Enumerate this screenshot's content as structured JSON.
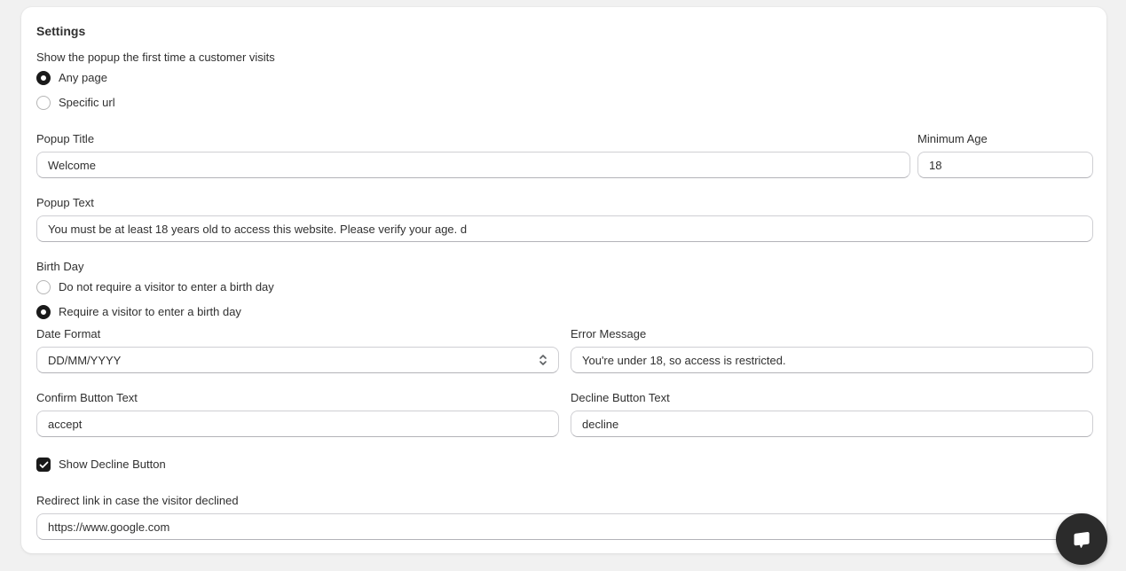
{
  "page": {
    "background_color": "#f1f1f1",
    "card_background_color": "#ffffff",
    "accent_dark": "#1a1a1a"
  },
  "settings": {
    "title": "Settings",
    "visit_section": {
      "label": "Show the popup the first time a customer visits",
      "options": [
        {
          "label": "Any page",
          "selected": "true"
        },
        {
          "label": "Specific url",
          "selected": "false"
        }
      ]
    },
    "popup_title": {
      "label": "Popup Title",
      "value": "Welcome"
    },
    "minimum_age": {
      "label": "Minimum Age",
      "value": "18"
    },
    "popup_text": {
      "label": "Popup Text",
      "value": "You must be at least 18 years old to access this website. Please verify your age. d"
    },
    "birth_day": {
      "label": "Birth Day",
      "options": [
        {
          "label": "Do not require a visitor to enter a birth day",
          "selected": "false"
        },
        {
          "label": "Require a visitor to enter a birth day",
          "selected": "true"
        }
      ]
    },
    "date_format": {
      "label": "Date Format",
      "value": "DD/MM/YYYY"
    },
    "error_message": {
      "label": "Error Message",
      "value": "You're under 18, so access is restricted."
    },
    "confirm_button_text": {
      "label": "Confirm Button Text",
      "value": "accept"
    },
    "decline_button_text": {
      "label": "Decline Button Text",
      "value": "decline"
    },
    "show_decline_button": {
      "label": "Show Decline Button",
      "checked": "true"
    },
    "redirect_link": {
      "label": "Redirect link in case the visitor declined",
      "value": "https://www.google.com"
    }
  },
  "chat_widget": {
    "icon": "chat-bubble-icon",
    "background_color": "#2b2b2b"
  }
}
